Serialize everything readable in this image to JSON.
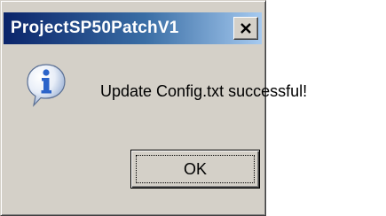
{
  "window": {
    "title": "ProjectSP50PatchV1",
    "close_glyph": "×"
  },
  "dialog": {
    "icon": "info-icon",
    "message": "Update Config.txt successful!",
    "ok_label": "OK"
  },
  "colors": {
    "titlebar_start": "#0a246a",
    "titlebar_end": "#a6caf0",
    "face": "#d4d0c8",
    "icon_blue": "#2b63c9"
  }
}
